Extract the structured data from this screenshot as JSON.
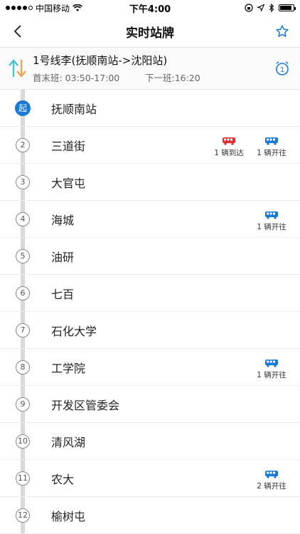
{
  "status": {
    "carrier": "中国移动",
    "time": "下午4:00"
  },
  "nav": {
    "title": "实时站牌"
  },
  "route": {
    "name": "1号线李(抚顺南站->沈阳站)",
    "first_last": "首末班: 03:50-17:00",
    "next": "下一班:16:20"
  },
  "colors": {
    "accent": "#1a78d6",
    "arrived_bus": "#e0302e",
    "departing_bus": "#1a78d6"
  },
  "stops": [
    {
      "index": "起",
      "name": "抚顺南站",
      "buses": []
    },
    {
      "index": "2",
      "name": "三道街",
      "buses": [
        {
          "type": "arrived",
          "icon": "bus-icon",
          "label": "1 辆到达"
        },
        {
          "type": "departing",
          "icon": "bus-icon",
          "label": "1 辆开往"
        }
      ]
    },
    {
      "index": "3",
      "name": "大官屯",
      "buses": []
    },
    {
      "index": "4",
      "name": "海城",
      "buses": [
        {
          "type": "departing",
          "icon": "bus-icon",
          "label": "1 辆开往"
        }
      ]
    },
    {
      "index": "5",
      "name": "油研",
      "buses": []
    },
    {
      "index": "6",
      "name": "七百",
      "buses": []
    },
    {
      "index": "7",
      "name": "石化大学",
      "buses": []
    },
    {
      "index": "8",
      "name": "工学院",
      "buses": [
        {
          "type": "departing",
          "icon": "bus-icon",
          "label": "1 辆开往"
        }
      ]
    },
    {
      "index": "9",
      "name": "开发区管委会",
      "buses": []
    },
    {
      "index": "10",
      "name": "清风湖",
      "buses": []
    },
    {
      "index": "11",
      "name": "农大",
      "buses": [
        {
          "type": "departing",
          "icon": "bus-icon",
          "label": "2 辆开往"
        }
      ]
    },
    {
      "index": "12",
      "name": "榆树屯",
      "buses": []
    }
  ]
}
